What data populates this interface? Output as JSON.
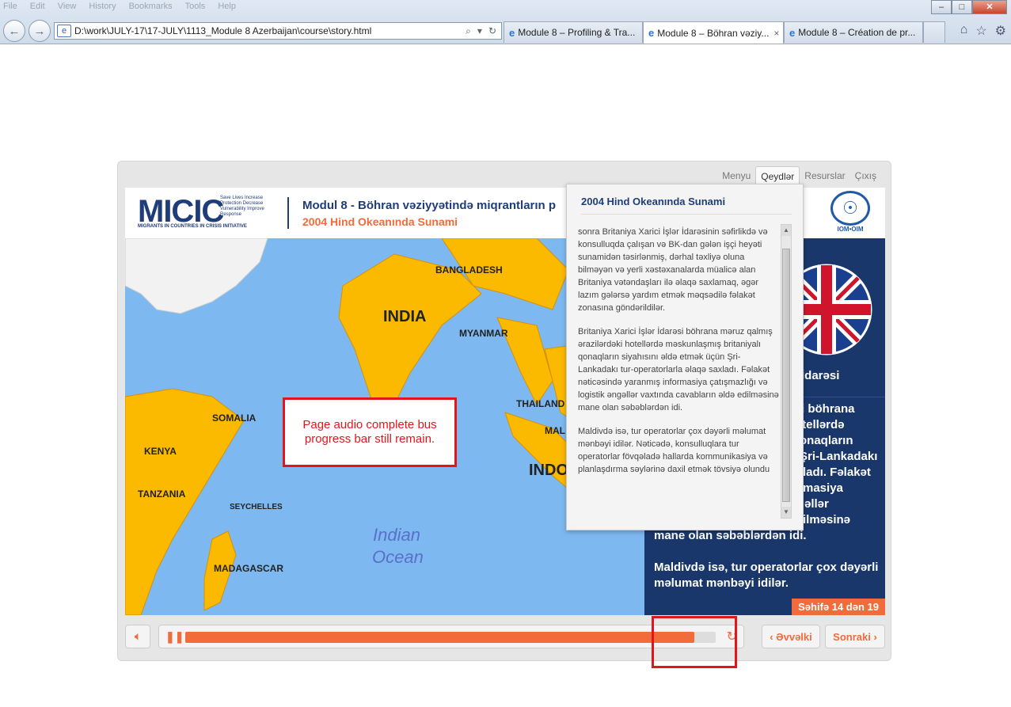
{
  "browser": {
    "menu": [
      "File",
      "Edit",
      "View",
      "History",
      "Bookmarks",
      "Tools",
      "Help"
    ],
    "address": "D:\\work\\JULY-17\\17-JULY\\1113_Module 8 Azerbaijan\\course\\story.html",
    "tabs": [
      {
        "label": "Module 8 – Profiling & Tra..."
      },
      {
        "label": "Module 8 – Böhran vəziy..."
      },
      {
        "label": "Module 8 – Création de pr..."
      }
    ],
    "close_tab_glyph": "×",
    "win_min": "–",
    "win_max": "□",
    "win_close": "✕"
  },
  "player": {
    "topnav": [
      "Menyu",
      "Qeydlər",
      "Resurslar",
      "Çıxış"
    ],
    "header": {
      "logo": "MICIC",
      "logo_tag": "Save Lives Increase Protection Decrease Vulnerability Improve Response",
      "logo_sub": "MIGRANTS IN COUNTRIES IN CRISIS INITIATIVE",
      "title": "Modul 8 - Böhran vəziyyətində miqrantların p",
      "subtitle": "2004 Hind Okeanında Sunami",
      "iom": "IOM•OIM"
    },
    "map_labels": {
      "bangladesh": "BANGLADESH",
      "india": "INDIA",
      "myanmar": "MYANMAR",
      "thailand": "THAILAND",
      "somalia": "SOMALIA",
      "kenya": "KENYA",
      "tanzania": "TANZANIA",
      "seychelles": "SEYCHELLES",
      "madagascar": "MADAGASCAR",
      "mal": "MAL",
      "indo": "INDO",
      "ocean1": "Indian",
      "ocean2": "Ocean"
    },
    "sidebar": {
      "l1": "İdarəsi",
      "l2": "i böhrana",
      "l3": "otellərdə",
      "l4": "onaqların",
      "l5": "Şri-Lankadakı",
      "l6": "ladı. Fəlakət",
      "l7": "masiya",
      "l8": "əllər",
      "l9": "ilməsinə",
      "l10": "mane olan səbəblərdən idi.",
      "l11": "Maldivdə isə, tur operatorlar çox dəyərli",
      "l12": "məlumat mənbəyi idilər.",
      "page": "Səhifə 14 dən 19"
    },
    "notes": {
      "title": "2004 Hind Okeanında Sunami",
      "p1": "sonra Britaniya Xarici İşlər İdarəsinin səfirlikdə və konsulluqda çalışan və BK-dan gələn işçi heyəti sunamidən təsirlənmiş, dərhal təxliyə oluna bilməyən və yerli xəstəxanalarda müalicə alan Britaniya vətəndaşları ilə əlaqə saxlamaq, əgər lazım gələrsə yardım etmək məqsədilə fəlakət zonasına göndərildilər.",
      "p2": "Britaniya Xarici İşlər İdarəsi böhrana məruz qalmış ərazilərdəki hotellərdə məskunlaşmış britaniyalı qonaqların siyahısını əldə etmək üçün Şri-Lankadakı tur-operatorlarla əlaqə saxladı. Fəlakət nəticəsində yaranmış informasiya çatışmazlığı və logistik əngəllər vaxtında cavabların əldə edilməsinə mane olan səbəblərdən idi.",
      "p3": "Maldivdə isə, tur operatorlar çox dəyərli məlumat mənbəyi idilər. Nəticədə, konsulluqlara tur operatorlar fövqəladə hallarda kommunikasiya və planlaşdırma səylərinə daxil etmək tövsiyə olundu"
    },
    "controls": {
      "prev": "Əvvəlki",
      "next": "Sonraki",
      "progress": 0.96
    }
  },
  "annotation": {
    "text": "Page audio complete bus progress bar still remain."
  },
  "colors": {
    "accent": "#f26b3a",
    "navy": "#1f3d7a",
    "annotation": "#e3151b"
  }
}
